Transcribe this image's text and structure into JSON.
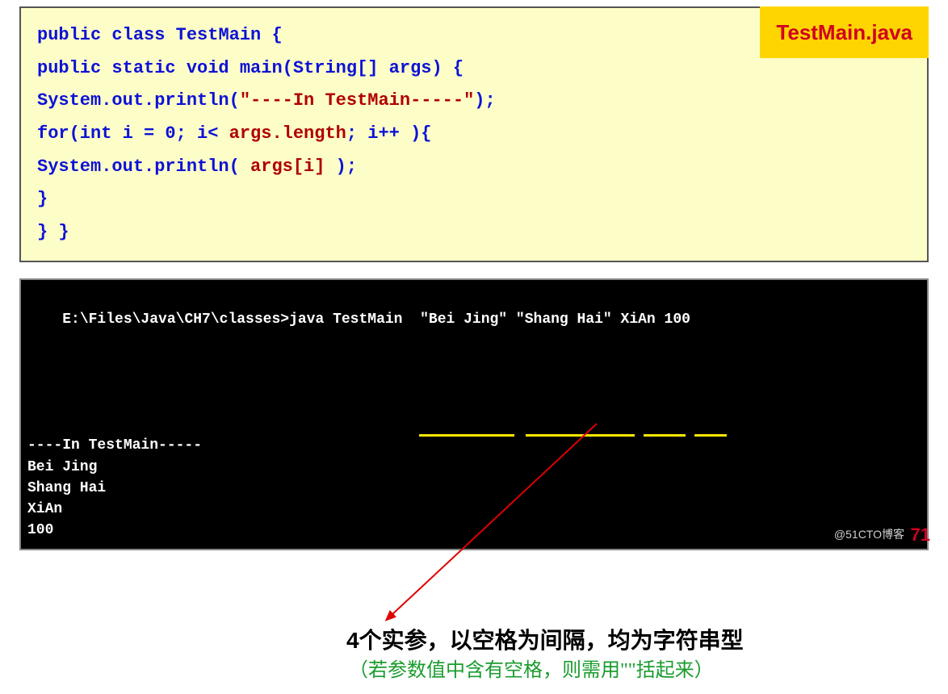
{
  "filename": "TestMain.java",
  "code": {
    "l1_a": "public class ",
    "l1_b": "TestMain {",
    "l2_a": "    public static void ",
    "l2_b": "main(String[] args) {",
    "l3_a": "        System.out.println(",
    "l3_str": "\"----In TestMain-----\"",
    "l3_b": ");",
    "l4_a": "        for(int i = 0; i< ",
    "l4_b": "args.length",
    "l4_c": "; i++ ){",
    "l5_a": "             System.out.println( ",
    "l5_b": "args[i]",
    "l5_c": " );",
    "l6": "        }",
    "l7": "}   }"
  },
  "term": {
    "prompt": "E:\\Files\\Java\\CH7\\classes>java TestMain  \"Bei Jing\" \"Shang Hai\" XiAn 100",
    "out1": "----In TestMain-----",
    "out2": "Bei Jing",
    "out3": "Shang Hai",
    "out4": "XiAn",
    "out5": "100"
  },
  "annotation": {
    "main_prefix": "4",
    "main_rest": "个实参，以空格为间隔，均为字符串型",
    "sub": "（若参数值中含有空格，则需用\"\"括起来）"
  },
  "page": "71",
  "watermark": "@51CTO博客"
}
